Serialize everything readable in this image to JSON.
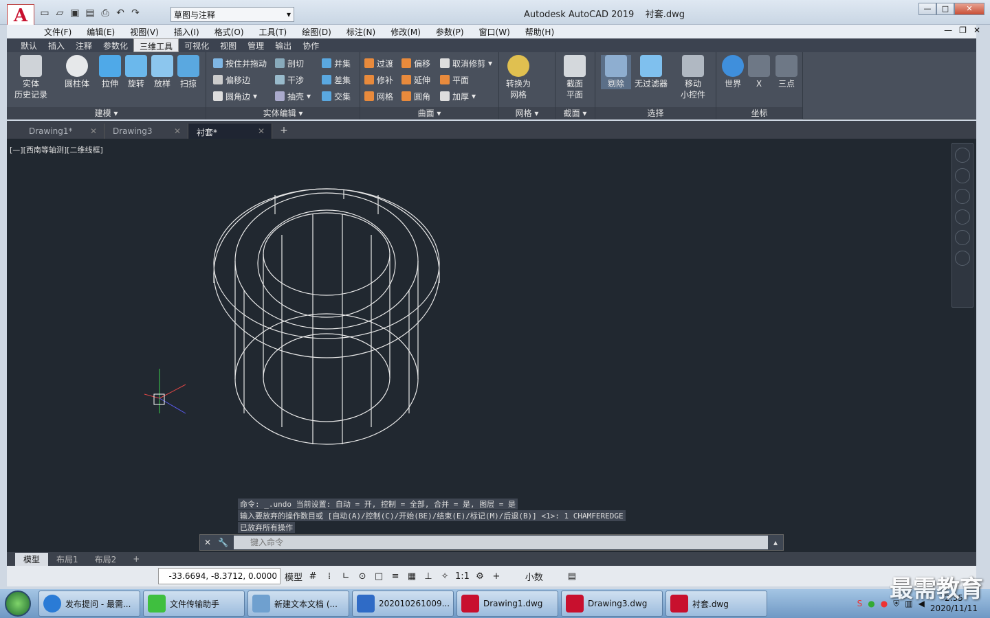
{
  "window": {
    "title": "Autodesk AutoCAD 2019",
    "filename": "衬套.dwg",
    "workspace": "草图与注释"
  },
  "menu": [
    "文件(F)",
    "编辑(E)",
    "视图(V)",
    "插入(I)",
    "格式(O)",
    "工具(T)",
    "绘图(D)",
    "标注(N)",
    "修改(M)",
    "参数(P)",
    "窗口(W)",
    "帮助(H)"
  ],
  "ribbon_tabs": [
    "默认",
    "插入",
    "注释",
    "参数化",
    "三维工具",
    "可视化",
    "视图",
    "管理",
    "输出",
    "协作"
  ],
  "ribbon": {
    "p1": {
      "title": "建模",
      "btn_solid": "实体\n历史记录",
      "btn_cyl": "圆柱体",
      "btn_ext": "拉伸",
      "btn_rev": "旋转",
      "btn_loft": "放样",
      "btn_sweep": "扫掠"
    },
    "p2": {
      "title": "实体编辑",
      "a": "按住并拖动",
      "b": "剖切",
      "c": "并集",
      "d": "偏移边",
      "e": "干涉",
      "f": "差集",
      "g": "圆角边",
      "h": "抽壳",
      "i": "交集"
    },
    "p3": {
      "title": "曲面",
      "a": "过渡",
      "b": "偏移",
      "c": "取消修剪",
      "d": "修补",
      "e": "延伸",
      "f": "平面",
      "g": "网格",
      "h": "圆角",
      "i": "加厚"
    },
    "p4": {
      "title": "网格",
      "btn": "转换为\n网格"
    },
    "p5": {
      "title": "截面",
      "btn": "截面\n平面"
    },
    "p6": {
      "title": "选择",
      "a": "剔除",
      "b": "无过滤器",
      "c": "移动\n小控件"
    },
    "p7": {
      "title": "坐标",
      "a": "世界",
      "b": "X",
      "c": "三点"
    }
  },
  "doc_tabs": [
    "Drawing1*",
    "Drawing3",
    "衬套*"
  ],
  "viewport_label": "[—][西南等轴测][二维线框]",
  "command": {
    "history": [
      "命令: _.undo 当前设置: 自动 = 开, 控制 = 全部, 合并 = 是, 图层 = 是",
      "输入要放弃的操作数目或 [自动(A)/控制(C)/开始(BE)/结束(E)/标记(M)/后退(B)] <1>: 1 CHAMFEREDGE",
      "已放弃所有操作"
    ],
    "placeholder": "键入命令"
  },
  "layout_tabs": [
    "模型",
    "布局1",
    "布局2"
  ],
  "status": {
    "coords": "-33.6694, -8.3712, 0.0000",
    "model": "模型",
    "scale": "1:1",
    "units": "小数"
  },
  "taskbar": [
    "发布提问 - 最需...",
    "文件传输助手",
    "新建文本文档 (...",
    "202010261009...",
    "Drawing1.dwg",
    "Drawing3.dwg",
    "衬套.dwg"
  ],
  "clock": {
    "time": "2:35",
    "date": "2020/11/11"
  },
  "watermark": "最需教育"
}
